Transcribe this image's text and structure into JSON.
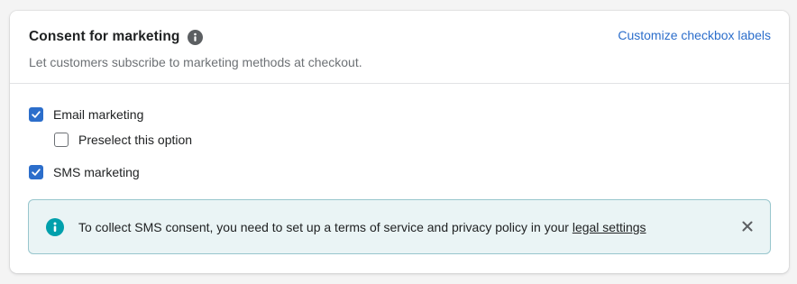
{
  "section": {
    "title": "Consent for marketing",
    "subtitle": "Let customers subscribe to marketing methods at checkout.",
    "customize_link": "Customize checkbox labels"
  },
  "options": [
    {
      "label": "Email marketing",
      "checked": true
    },
    {
      "label": "Preselect this option",
      "checked": false
    },
    {
      "label": "SMS marketing",
      "checked": true
    }
  ],
  "banner": {
    "text": "To collect SMS consent, you need to set up a terms of service and privacy policy in your ",
    "link": "legal settings"
  },
  "colors": {
    "accent": "#2c6ecb",
    "banner_bg": "#eaf4f5",
    "banner_icon": "#00a0ac"
  },
  "icons": {
    "title_info": "info-icon",
    "banner_info": "info-circle-icon",
    "close": "close-icon",
    "checkmark": "checkmark-icon"
  }
}
